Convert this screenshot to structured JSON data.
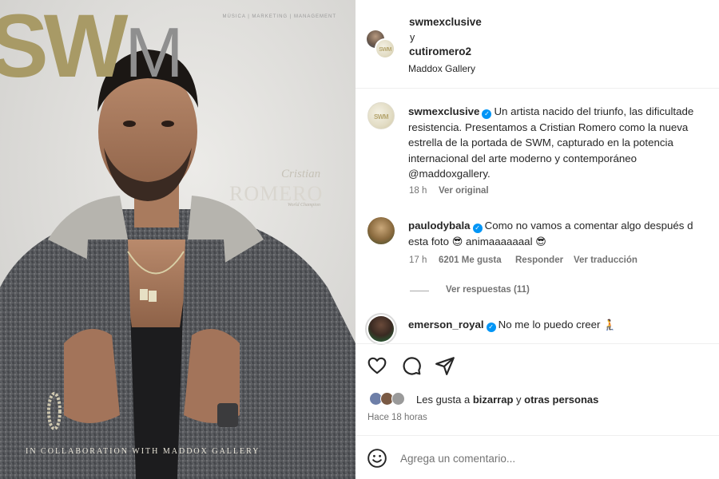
{
  "cover": {
    "logo_main": "SW",
    "logo_thin": "M",
    "top_line": "MÚSICA | MARKETING | MANAGEMENT",
    "name_first": "Cristian",
    "name_last": "ROMERO",
    "name_sub": "World Champion",
    "collab": "In collaboration with Maddox Gallery"
  },
  "header": {
    "user1": "swmexclusive",
    "joiner": "y",
    "user2": "cutiromero2",
    "location": "Maddox Gallery"
  },
  "caption": {
    "username": "swmexclusive",
    "text": "Un artista nacido del triunfo, las dificultades y la resistencia. Presentamos a Cristian Romero como la nueva estrella de la portada de SWM, capturado en la potencia internacional del arte moderno y contemporáneo @maddoxgallery.",
    "line1": "Un artista nacido del triunfo, las dificultade",
    "line2": "resistencia. Presentamos a Cristian Romero como la nueva",
    "line3": "estrella de la portada de SWM, capturado en la potencia",
    "line4": "internacional del arte moderno y contemporáneo",
    "line5": "@maddoxgallery.",
    "time": "18 h",
    "see_original": "Ver original"
  },
  "comments": [
    {
      "username": "paulodybala",
      "line1": "Como no vamos a comentar algo después d",
      "line2_a": "esta foto",
      "line2_b": "animaaaaaaal",
      "time": "17 h",
      "likes": "6201 Me gusta",
      "reply": "Responder",
      "translate": "Ver traducción",
      "view_replies": "Ver respuestas (11)"
    },
    {
      "username": "emerson_royal",
      "text": "No me lo puedo creer"
    }
  ],
  "actions": {
    "like_icon": "heart-icon",
    "comment_icon": "comment-icon",
    "share_icon": "share-icon"
  },
  "likes": {
    "prefix": "Les gusta a ",
    "user": "bizarrap",
    "middle": " y ",
    "others": "otras personas"
  },
  "post_time": "Hace 18 horas",
  "comment_box": {
    "placeholder": "Agrega un comentario..."
  },
  "colors": {
    "verified": "#0095f6",
    "text": "#262626",
    "secondary": "#737373",
    "logo_gold": "#a89a66"
  }
}
